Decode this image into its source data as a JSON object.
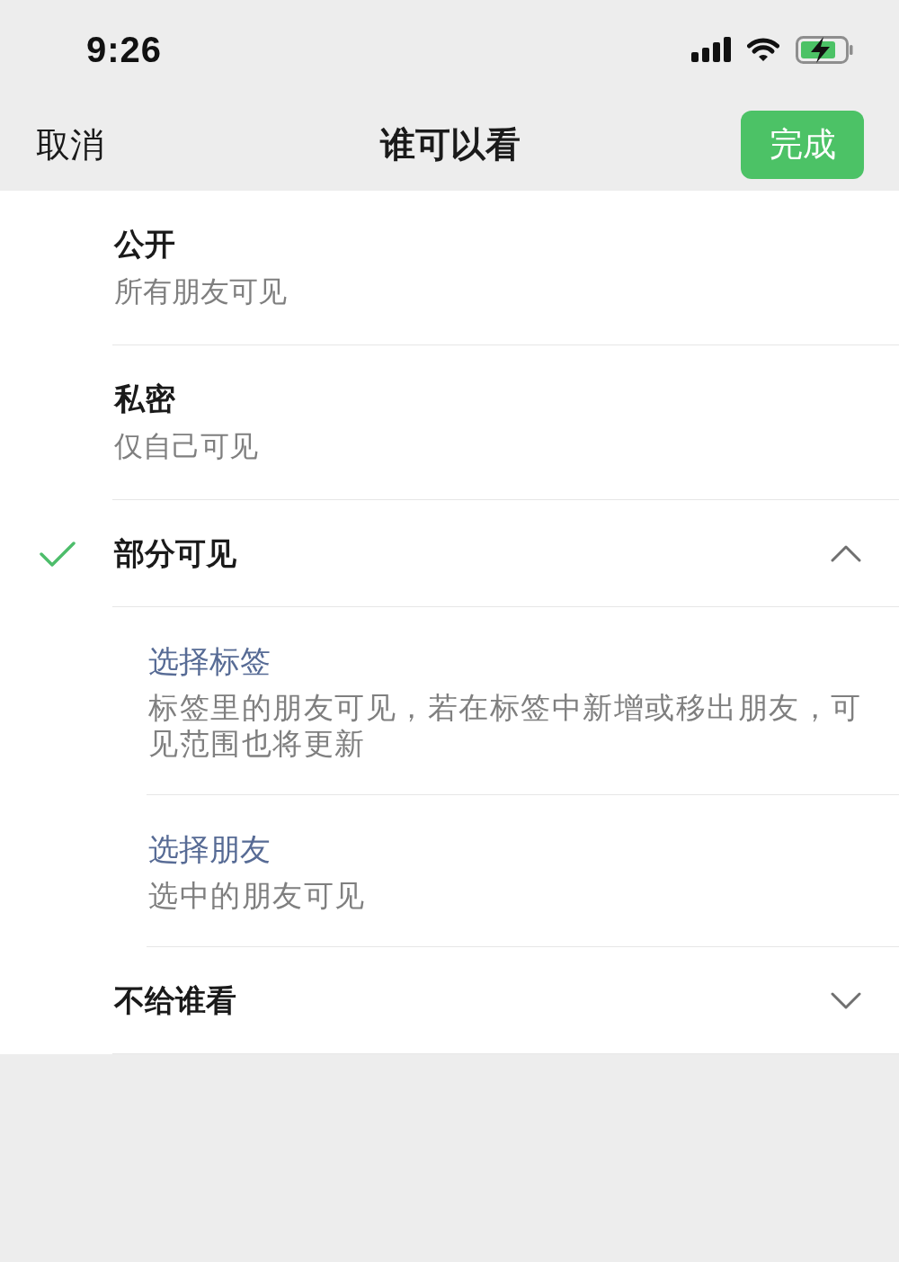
{
  "status_bar": {
    "time": "9:26"
  },
  "nav": {
    "cancel": "取消",
    "title": "谁可以看",
    "done": "完成"
  },
  "options": [
    {
      "kind": "plain",
      "title": "公开",
      "subtitle": "所有朋友可见",
      "selected": false
    },
    {
      "kind": "plain",
      "title": "私密",
      "subtitle": "仅自己可见",
      "selected": false
    },
    {
      "kind": "expandable",
      "title": "部分可见",
      "selected": true,
      "expanded": true,
      "children": [
        {
          "title": "选择标签",
          "subtitle": "标签里的朋友可见，若在标签中新增或移出朋友，可见范围也将更新"
        },
        {
          "title": "选择朋友",
          "subtitle": "选中的朋友可见"
        }
      ]
    },
    {
      "kind": "expandable",
      "title": "不给谁看",
      "selected": false,
      "expanded": false
    }
  ]
}
